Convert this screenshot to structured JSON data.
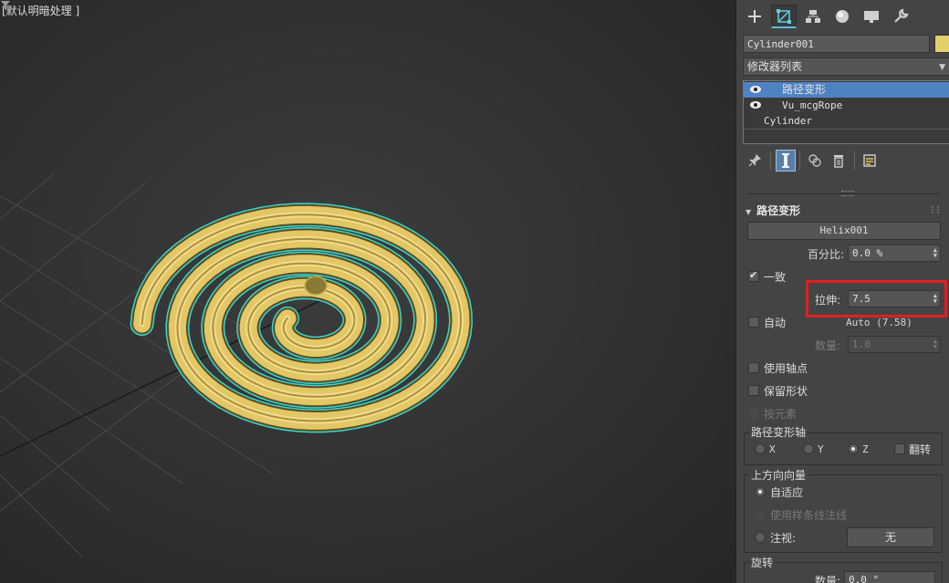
{
  "viewport": {
    "label": "[默认明暗处理 ]",
    "filter_icon": "funnel-icon",
    "object_color": "#e3c766",
    "selection_outline_color": "#34d6d3"
  },
  "command_panel": {
    "tabs": [
      {
        "icon": "plus-icon",
        "name": "create"
      },
      {
        "icon": "modify-icon",
        "name": "modify"
      },
      {
        "icon": "hierarchy-icon",
        "name": "hierarchy"
      },
      {
        "icon": "motion-icon",
        "name": "motion"
      },
      {
        "icon": "display-icon",
        "name": "display"
      },
      {
        "icon": "wrench-icon",
        "name": "utilities"
      }
    ],
    "object_name": "Cylinder001",
    "object_color": "#e2d16a",
    "modifier_list_label": "修改器列表",
    "stack": [
      {
        "label": "路径变形",
        "selected": true,
        "eye": true
      },
      {
        "label": "Vu_mcgRope",
        "selected": false,
        "eye": true
      },
      {
        "label": "Cylinder",
        "selected": false,
        "eye": false
      }
    ],
    "stack_tools": [
      "pin-icon",
      "show-end-result-icon",
      "make-unique-icon",
      "trash-icon",
      "configure-icon"
    ]
  },
  "path_deform": {
    "title": "路径变形",
    "path_button": "Helix001",
    "percent_label": "百分比:",
    "percent_value": "0.0 %",
    "uniform_label": "一致",
    "uniform_checked": true,
    "stretch_label": "拉伸:",
    "stretch_value": "7.5",
    "auto_label": "自动",
    "auto_checked": false,
    "auto_value": "Auto (7.58)",
    "amount_label": "数量:",
    "amount_value": "1.0",
    "use_pivot_label": "使用轴点",
    "preserve_shape_label": "保留形状",
    "by_element_label": "按元素",
    "axis_group_title": "路径变形轴",
    "axes": [
      {
        "label": "X",
        "selected": false
      },
      {
        "label": "Y",
        "selected": false
      },
      {
        "label": "Z",
        "selected": true
      }
    ],
    "flip_label": "翻转",
    "up_vector_group_title": "上方向向量",
    "adaptive_label": "自适应",
    "use_spline_normals_label": "使用样条线法线",
    "look_at_label": "注视:",
    "look_at_button": "无",
    "rotation_title": "旋转",
    "rotation_amount_label": "数量:",
    "rotation_amount_value": "0.0 °"
  }
}
